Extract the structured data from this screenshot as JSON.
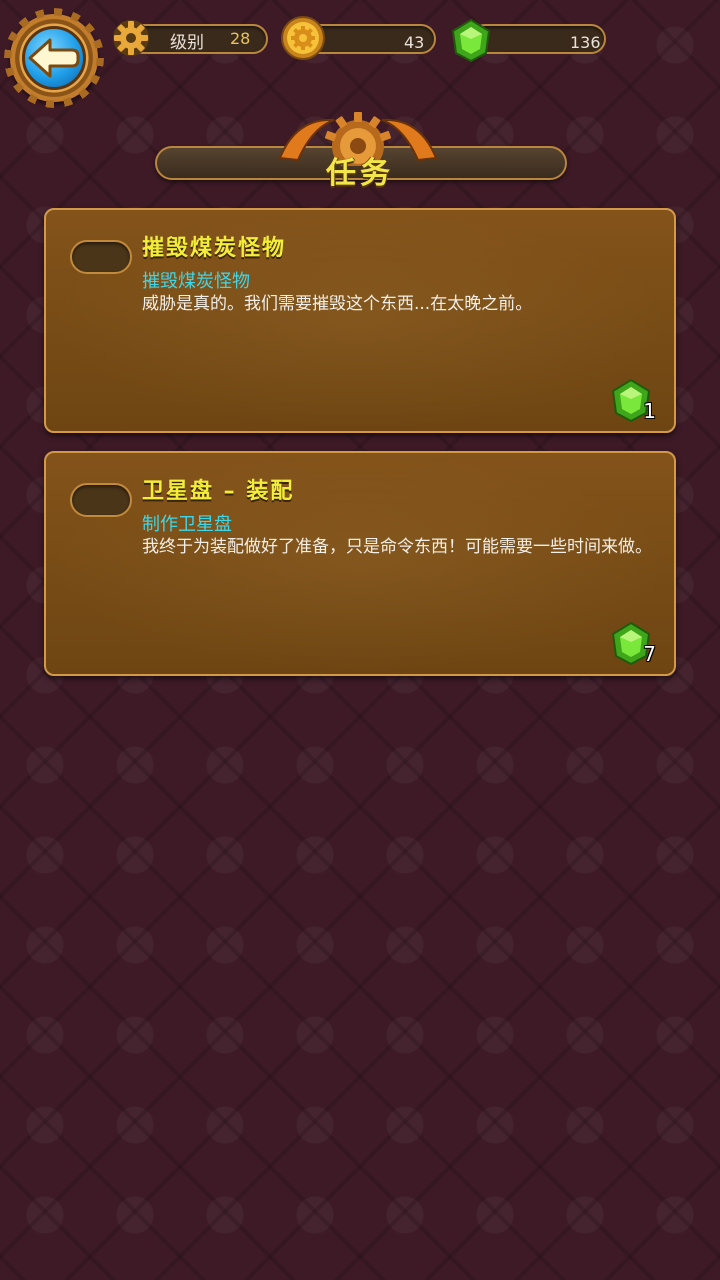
{
  "hud": {
    "level_label": "级别",
    "level_value": "28",
    "coins": "43",
    "gems": "136"
  },
  "icons": {
    "back": "back-arrow-icon",
    "level": "gear-icon",
    "coins": "gold-coin-icon",
    "gems": "green-gem-icon",
    "reward": "green-gem-icon"
  },
  "colors": {
    "background": "#3d1a26",
    "card": "#7a4c16",
    "card_border": "#d29a48",
    "quest_title": "#f2ec3a",
    "quest_subtitle": "#3fd6e8",
    "banner_title": "#f2e64a",
    "gem": "#5fd32a",
    "back_button": "#1f9ee8"
  },
  "title": "任务",
  "quests": [
    {
      "title": "摧毁煤炭怪物",
      "subtitle": "摧毁煤炭怪物",
      "description": "威胁是真的。我们需要摧毁这个东西...在太晚之前。",
      "reward": "1"
    },
    {
      "title": "卫星盘 – 装配",
      "subtitle": "制作卫星盘",
      "description": "我终于为装配做好了准备，只是命令东西！可能需要一些时间来做。",
      "reward": "7"
    }
  ]
}
